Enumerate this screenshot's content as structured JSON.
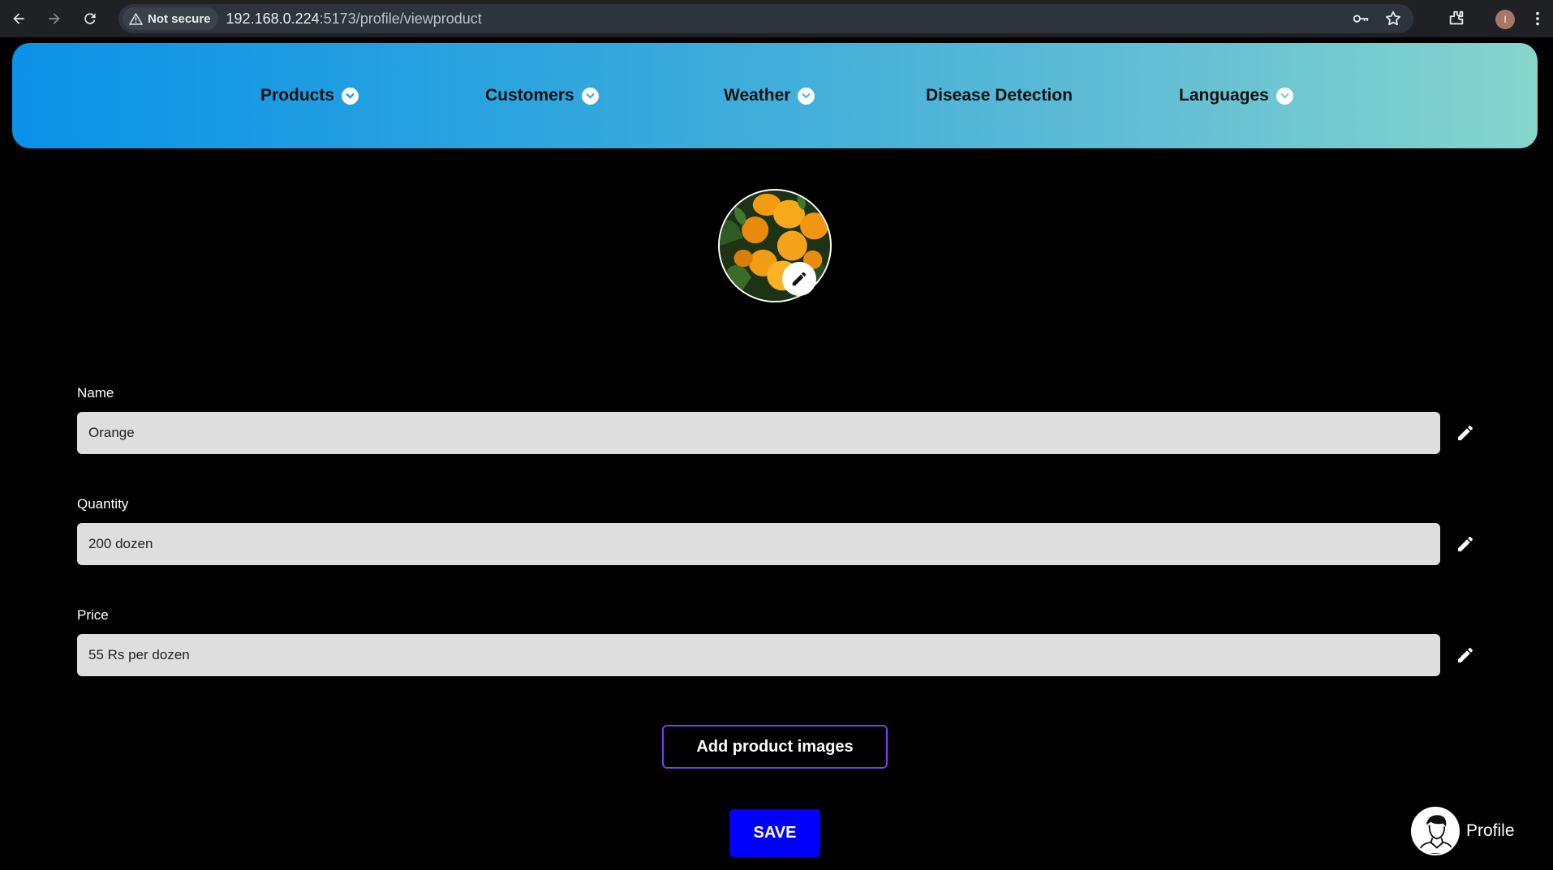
{
  "browser": {
    "security_label": "Not secure",
    "url_host": "192.168.0.224",
    "url_rest": ":5173/profile/viewproduct",
    "avatar_initial": "I"
  },
  "navbar": {
    "items": [
      {
        "label": "Products",
        "dropdown": true
      },
      {
        "label": "Customers",
        "dropdown": true
      },
      {
        "label": "Weather",
        "dropdown": true
      },
      {
        "label": "Disease Detection",
        "dropdown": false
      },
      {
        "label": "Languages",
        "dropdown": true
      }
    ]
  },
  "product": {
    "image_icon": "oranges-photo",
    "fields": [
      {
        "label": "Name",
        "value": "Orange"
      },
      {
        "label": "Quantity",
        "value": "200 dozen"
      },
      {
        "label": "Price",
        "value": "55 Rs per dozen"
      }
    ]
  },
  "actions": {
    "add_images_label": "Add product images",
    "save_label": "SAVE"
  },
  "profile": {
    "label": "Profile"
  },
  "colors": {
    "navbar_gradient_start": "#0a92e8",
    "navbar_gradient_end": "#86d6cc",
    "save_button": "#0000ff",
    "add_images_border": "#7b3fe4",
    "input_background": "#dedede"
  }
}
